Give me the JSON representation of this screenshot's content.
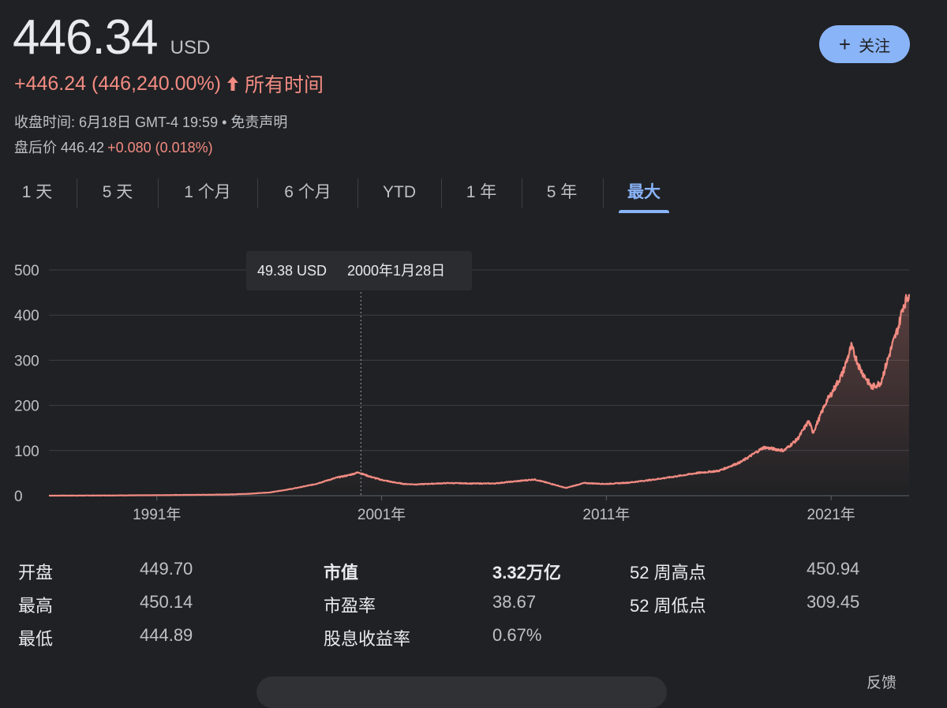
{
  "quote": {
    "price": "446.34",
    "currency": "USD",
    "change": "+446.24 (446,240.00%)",
    "period": "所有时间",
    "close_label": "收盘时间: 6月18日 GMT-4 19:59 • ",
    "disclaimer": "免责声明",
    "after_label": "盘后价 446.42",
    "after_change": "+0.080 (0.018%)"
  },
  "follow_label": "关注",
  "tabs": [
    "1 天",
    "5 天",
    "1 个月",
    "6 个月",
    "YTD",
    "1 年",
    "5 年",
    "最大"
  ],
  "active_tab": 7,
  "tooltip": {
    "value": "49.38 USD",
    "date": "2000年1月28日"
  },
  "colors": {
    "line": "#f28b82",
    "accent": "#8ab4f8",
    "background": "#202124"
  },
  "chart_data": {
    "type": "area",
    "xlim": [
      1986.2,
      2024.47
    ],
    "ylim": [
      0,
      500
    ],
    "y_ticks": [
      0,
      100,
      200,
      300,
      400,
      500
    ],
    "x_ticks": [
      {
        "year": 1991,
        "label": "1991年"
      },
      {
        "year": 2001,
        "label": "2001年"
      },
      {
        "year": 2011,
        "label": "2011年"
      },
      {
        "year": 2021,
        "label": "2021年"
      }
    ],
    "grid": true,
    "hover": {
      "year": 2000.08,
      "value": 49.38
    },
    "series": [
      {
        "x": [
          1986.2,
          1988,
          1990,
          1992,
          1994,
          1995,
          1996,
          1997,
          1998,
          1999,
          1999.5,
          2000,
          2000.08,
          2000.5,
          2001,
          2001.5,
          2002,
          2002.5,
          2003,
          2004,
          2005,
          2006,
          2007,
          2007.8,
          2008.5,
          2009.2,
          2010,
          2011,
          2012,
          2013,
          2014,
          2015,
          2016,
          2017,
          2018,
          2018.9,
          2019.5,
          2020,
          2020.2,
          2020.8,
          2021,
          2021.5,
          2021.9,
          2022.3,
          2022.8,
          2023.2,
          2023.7,
          2024,
          2024.2,
          2024.47
        ],
        "y": [
          0.1,
          0.3,
          0.7,
          1.5,
          2.5,
          4,
          7,
          15,
          25,
          40,
          45,
          52,
          49.38,
          42,
          35,
          30,
          26,
          25,
          26,
          28,
          27,
          27,
          32,
          36,
          27,
          17,
          28,
          26,
          29,
          35,
          42,
          50,
          55,
          75,
          107,
          100,
          125,
          165,
          140,
          210,
          225,
          270,
          330,
          280,
          240,
          250,
          330,
          375,
          420,
          446.34
        ]
      }
    ]
  },
  "stats": {
    "col1": [
      {
        "label": "开盘",
        "value": "449.70"
      },
      {
        "label": "最高",
        "value": "450.14"
      },
      {
        "label": "最低",
        "value": "444.89"
      }
    ],
    "col2": [
      {
        "label": "市值",
        "value": "3.32万亿"
      },
      {
        "label": "市盈率",
        "value": "38.67"
      },
      {
        "label": "股息收益率",
        "value": "0.67%"
      }
    ],
    "col3": [
      {
        "label": "52 周高点",
        "value": "450.94"
      },
      {
        "label": "52 周低点",
        "value": "309.45"
      }
    ]
  },
  "feedback": "反馈"
}
